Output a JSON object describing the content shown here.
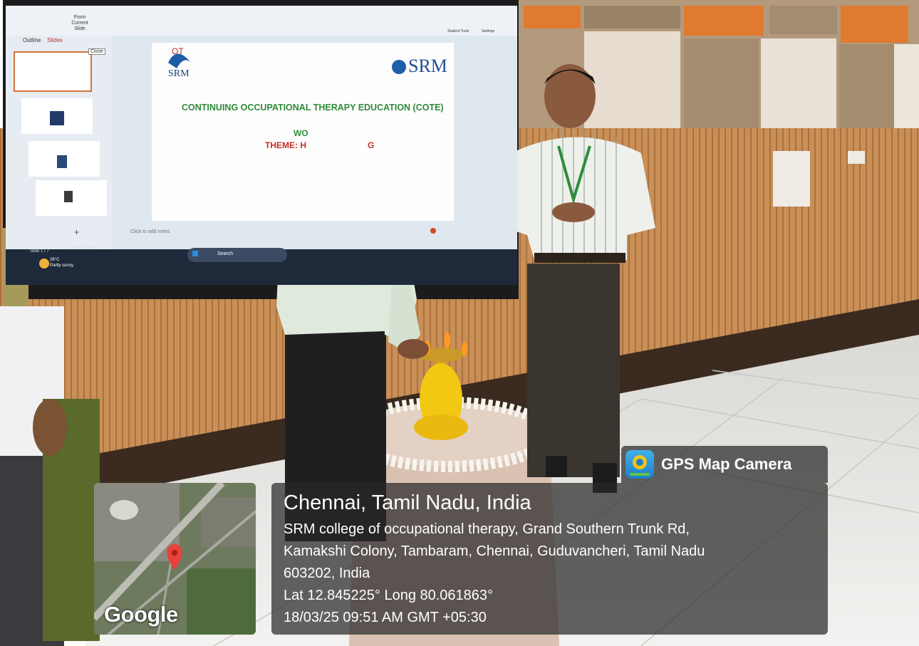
{
  "screen": {
    "slide_title": "CONTINUING OCCUPATIONAL THERAPY EDUCATION (COTE)",
    "slide_line2": "WO",
    "slide_theme": "THEME: H",
    "slide_theme_tail": "G",
    "logo_left_letters": "OT",
    "logo_left_name": "SRM",
    "logo_right_name": "SRM",
    "outline_tab": "Outline",
    "slides_tab": "Slides",
    "close_tooltip": "Close",
    "from_current_slide": "From Current Slide",
    "add_notes": "Click to add notes",
    "slide_counter": "Slide 1 / 7",
    "office_theme": "Office Theme",
    "taskbar_search": "Search",
    "weather_temp": "28°C",
    "weather_desc": "Partly sunny",
    "student_tools": "Student Tools",
    "settings": "Settings"
  },
  "map": {
    "brand": "Google"
  },
  "gps": {
    "app_name": "GPS Map Camera",
    "city": "Chennai, Tamil Nadu, India",
    "address_line1": "SRM college of occupational therapy, Grand Southern Trunk Rd,",
    "address_line2": "Kamakshi Colony, Tambaram, Chennai, Guduvancheri, Tamil Nadu",
    "address_line3": "603202, India",
    "coords": "Lat 12.845225° Long 80.061863°",
    "datetime": "18/03/25 09:51 AM GMT +05:30"
  },
  "colors": {
    "wall_wood": "#c48a52",
    "slide_green": "#2f8a3a",
    "slide_red": "#c0302a",
    "panel_bg": "#282828",
    "map_pin": "#e8413b"
  }
}
